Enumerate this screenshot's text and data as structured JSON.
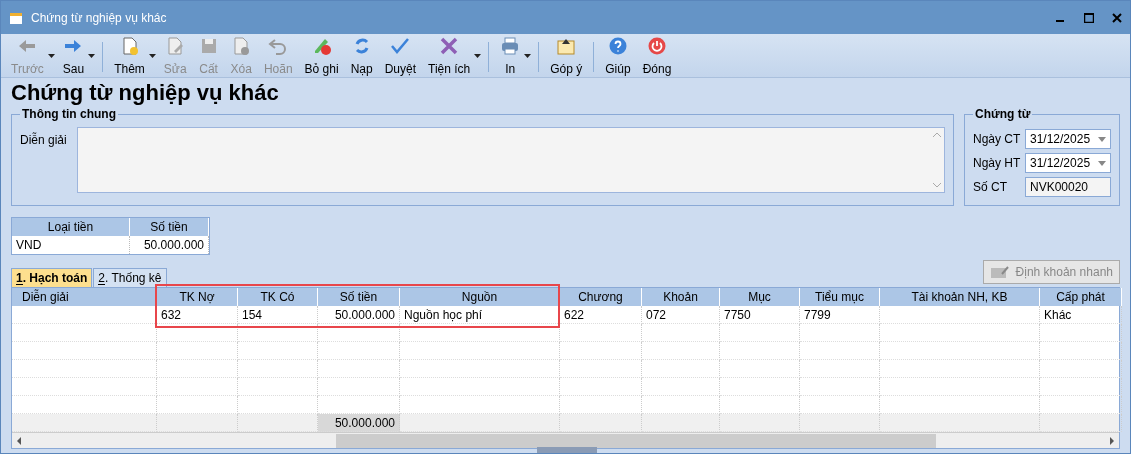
{
  "window": {
    "title": "Chứng từ nghiệp vụ khác"
  },
  "toolbar": [
    {
      "label": "Trước",
      "kind": "back",
      "disabled": true,
      "dropdown": true
    },
    {
      "label": "Sau",
      "kind": "forward",
      "disabled": false,
      "dropdown": true,
      "separator_after": true
    },
    {
      "label": "Thêm",
      "kind": "add",
      "disabled": false,
      "dropdown": true
    },
    {
      "label": "Sửa",
      "kind": "edit",
      "disabled": true,
      "dropdown": false
    },
    {
      "label": "Cất",
      "kind": "save",
      "disabled": true,
      "dropdown": false
    },
    {
      "label": "Xóa",
      "kind": "delete",
      "disabled": true,
      "dropdown": false
    },
    {
      "label": "Hoãn",
      "kind": "undo",
      "disabled": true,
      "dropdown": false
    },
    {
      "label": "Bỏ ghi",
      "kind": "unpost",
      "disabled": false,
      "dropdown": false
    },
    {
      "label": "Nạp",
      "kind": "reload",
      "disabled": false,
      "dropdown": false
    },
    {
      "label": "Duyệt",
      "kind": "check",
      "disabled": false,
      "dropdown": false
    },
    {
      "label": "Tiện ích",
      "kind": "tools",
      "disabled": false,
      "dropdown": true,
      "separator_after": true
    },
    {
      "label": "In",
      "kind": "print",
      "disabled": false,
      "dropdown": true,
      "separator_after": true
    },
    {
      "label": "Góp ý",
      "kind": "feedback",
      "disabled": false,
      "dropdown": false,
      "separator_after": true
    },
    {
      "label": "Giúp",
      "kind": "help",
      "disabled": false,
      "dropdown": false
    },
    {
      "label": "Đóng",
      "kind": "close",
      "disabled": false,
      "dropdown": false
    }
  ],
  "heading": "Chứng từ nghiệp vụ khác",
  "general": {
    "legend": "Thông tin chung",
    "description_label": "Diễn giải"
  },
  "voucher": {
    "legend": "Chứng từ",
    "fields": [
      {
        "label": "Ngày CT",
        "value": "31/12/2025",
        "kind": "date"
      },
      {
        "label": "Ngày HT",
        "value": "31/12/2025",
        "kind": "date"
      },
      {
        "label": "Số CT",
        "value": "NVK00020",
        "kind": "text"
      }
    ]
  },
  "currency_table": {
    "columns": [
      "Loại tiền",
      "Số tiền"
    ],
    "rows": [
      [
        "VND",
        "50.000.000"
      ]
    ]
  },
  "tabs": [
    {
      "label": "1. Hạch toán",
      "selected": true
    },
    {
      "label": "2. Thống kê",
      "selected": false
    }
  ],
  "quick_button": {
    "label": "Định khoản nhanh",
    "disabled": true
  },
  "grid": {
    "columns": [
      {
        "label": "Diễn giải",
        "highlighted": false
      },
      {
        "label": "TK Nợ",
        "highlighted": true
      },
      {
        "label": "TK Có",
        "highlighted": true
      },
      {
        "label": "Số tiền",
        "highlighted": true
      },
      {
        "label": "Nguồn",
        "highlighted": true
      },
      {
        "label": "Chương",
        "highlighted": false
      },
      {
        "label": "Khoản",
        "highlighted": false
      },
      {
        "label": "Mục",
        "highlighted": false
      },
      {
        "label": "Tiểu mục",
        "highlighted": false
      },
      {
        "label": "Tài khoản NH, KB",
        "highlighted": false
      },
      {
        "label": "Cấp phát",
        "highlighted": false
      }
    ],
    "rows": [
      [
        null,
        "632",
        "154",
        "50.000.000",
        "Nguồn học phí",
        "622",
        "072",
        "7750",
        "7799",
        null,
        "Khác"
      ]
    ],
    "totals": {
      "amount": "50.000.000"
    }
  }
}
